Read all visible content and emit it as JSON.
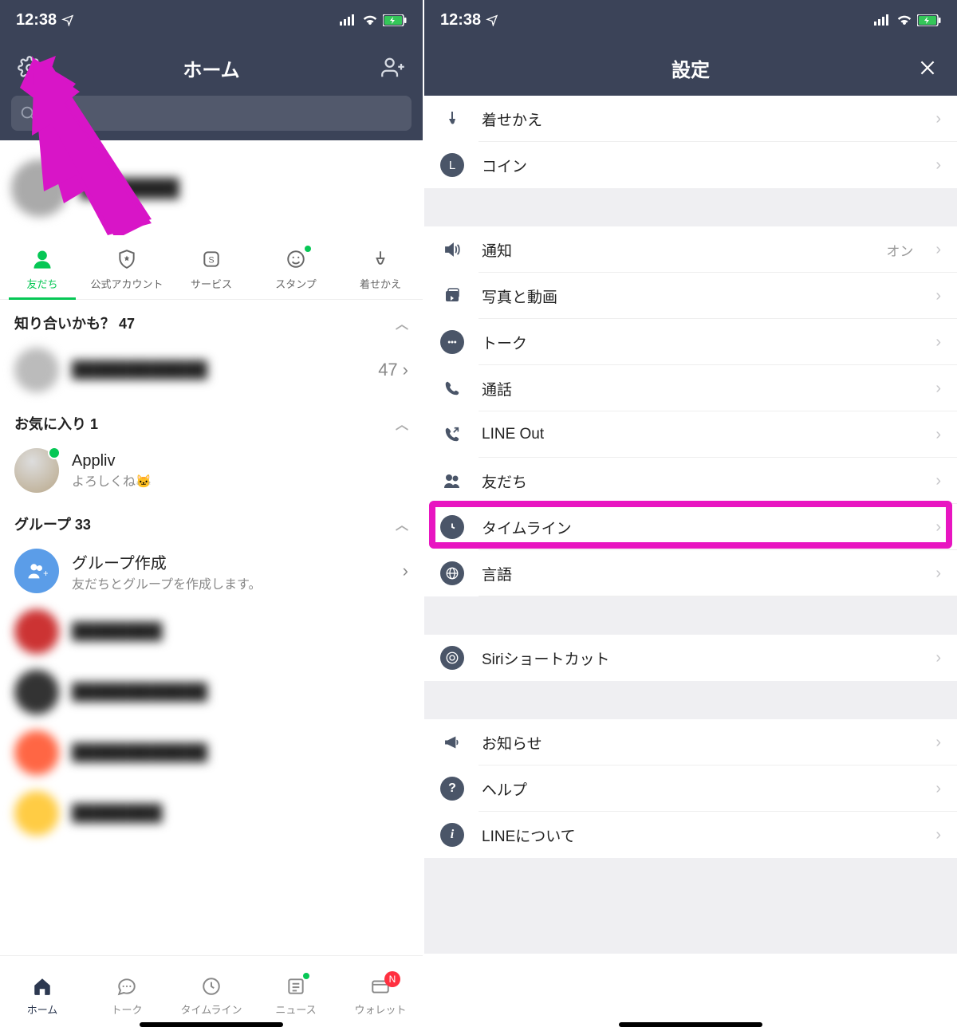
{
  "status": {
    "time": "12:38"
  },
  "left": {
    "title": "ホーム",
    "tabs": [
      {
        "label": "友だち"
      },
      {
        "label": "公式アカウント"
      },
      {
        "label": "サービス"
      },
      {
        "label": "スタンプ"
      },
      {
        "label": "着せかえ"
      }
    ],
    "sections": {
      "suggest": {
        "title": "知り合いかも？ 47",
        "count": "47"
      },
      "favorites": {
        "title": "お気に入り 1",
        "item": {
          "name": "Appliv",
          "sub": "よろしくね🐱"
        }
      },
      "groups": {
        "title": "グループ 33",
        "create": {
          "name": "グループ作成",
          "sub": "友だちとグループを作成します。"
        }
      }
    },
    "bottom_nav": [
      {
        "label": "ホーム"
      },
      {
        "label": "トーク"
      },
      {
        "label": "タイムライン"
      },
      {
        "label": "ニュース"
      },
      {
        "label": "ウォレット",
        "badge": "N"
      }
    ]
  },
  "right": {
    "title": "設定",
    "items": {
      "theme": "着せかえ",
      "coin": "コイン",
      "notification": "通知",
      "notification_value": "オン",
      "photo": "写真と動画",
      "talk": "トーク",
      "call": "通話",
      "lineout": "LINE Out",
      "friends": "友だち",
      "timeline": "タイムライン",
      "language": "言語",
      "siri": "Siriショートカット",
      "announce": "お知らせ",
      "help": "ヘルプ",
      "about": "LINEについて"
    }
  }
}
